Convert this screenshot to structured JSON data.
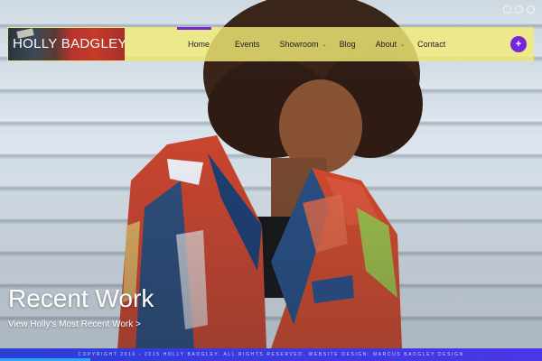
{
  "header": {
    "logo_text": "HOLLY BADGLEY",
    "nav": [
      {
        "label": "Home",
        "active": true,
        "has_submenu": false
      },
      {
        "label": "Events",
        "active": false,
        "has_submenu": false
      },
      {
        "label": "Showroom",
        "active": false,
        "has_submenu": true
      },
      {
        "label": "Blog",
        "active": false,
        "has_submenu": false
      },
      {
        "label": "About",
        "active": false,
        "has_submenu": true
      },
      {
        "label": "Contact",
        "active": false,
        "has_submenu": false
      }
    ],
    "submenu_caret": "⌄",
    "plus_button_label": "+",
    "bar_color": "#f1ea78",
    "accent_color": "#7327d8"
  },
  "hero": {
    "title": "Recent Work",
    "link_text": "View Holly's Most Recent Work >"
  },
  "footer": {
    "text": "Copyright 2016 - 2015 Holly Badgley. All rights reserved. Website Design: Marcus Badgley Design",
    "background": "#3a3ae0",
    "accent_color": "#2ea6ff"
  },
  "icons": {
    "top_right": [
      "circle-icon",
      "circle-icon",
      "circle-icon"
    ]
  }
}
